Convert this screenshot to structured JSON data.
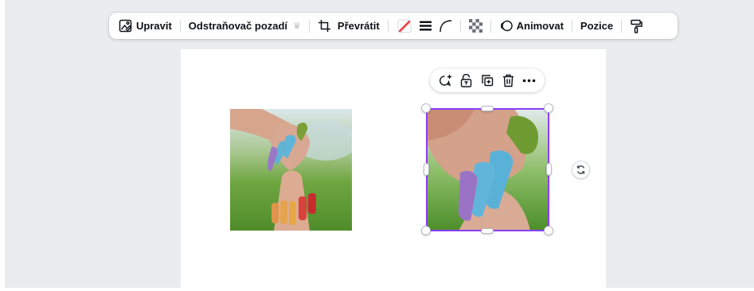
{
  "toolbar": {
    "edit_label": "Upravit",
    "bg_remover_label": "Odstraňovač pozadí",
    "flip_label": "Převrátit",
    "animate_label": "Animovat",
    "position_label": "Pozice"
  },
  "icons": {
    "edit": "edit-image-icon",
    "premium": "crown-icon",
    "crop": "crop-icon",
    "color": "no-color-icon",
    "border": "border-style-icon",
    "corner": "corner-rounding-icon",
    "transparency": "transparency-icon",
    "animate": "animate-icon",
    "copy_style": "paint-roller-icon",
    "comment": "comment-add-icon",
    "lock": "lock-icon",
    "duplicate": "duplicate-icon",
    "delete": "trash-icon",
    "more": "more-icon",
    "rotate": "rotate-icon"
  },
  "colors": {
    "selection": "#8b3dff",
    "canvas_bg": "#ebecf0",
    "page_bg": "#ffffff",
    "text": "#0e1318"
  }
}
